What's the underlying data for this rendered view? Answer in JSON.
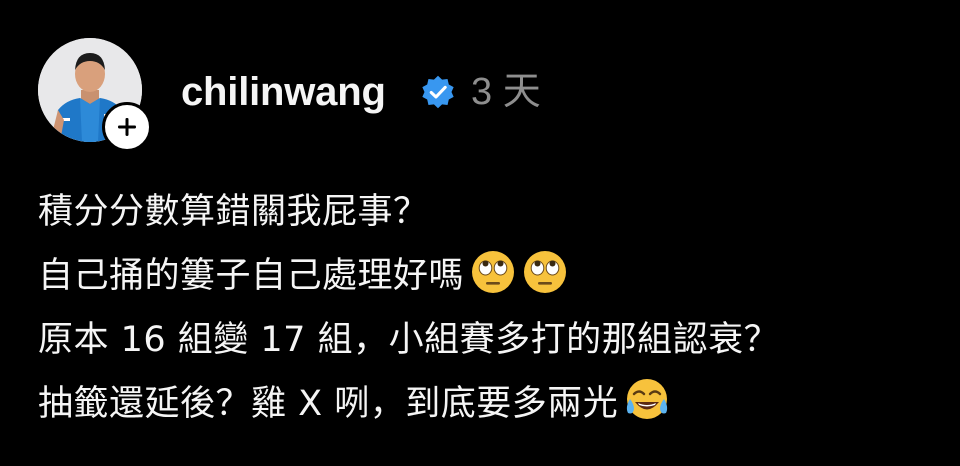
{
  "post": {
    "username": "chilinwang",
    "time": "3 天",
    "lines": [
      "積分分數算錯關我屁事？",
      "自己捅的簍子自己處理好嗎",
      "原本 16 組變 17 組，小組賽多打的那組認衰？",
      "抽籤還延後？雞 X 咧，到底要多兩光"
    ],
    "emojis": {
      "line2": [
        "face-with-rolling-eyes",
        "face-with-rolling-eyes"
      ],
      "line4": [
        "face-with-tears-of-joy"
      ]
    }
  },
  "colors": {
    "background": "#000000",
    "text": "#f5f5f5",
    "muted": "#8e8e8e",
    "verified": "#3897f0"
  }
}
